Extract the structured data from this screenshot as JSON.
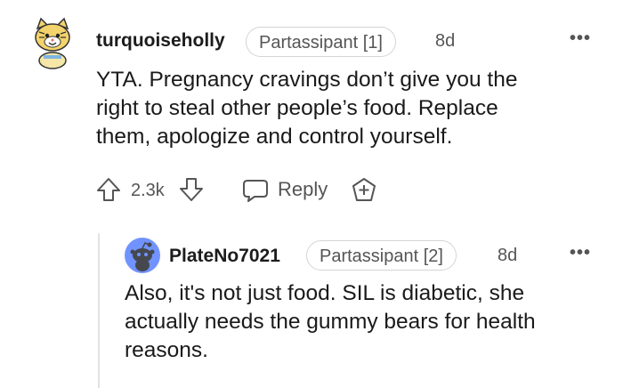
{
  "comment": {
    "username": "turquoiseholly",
    "flair": "Partassipant [1]",
    "age": "8d",
    "more": "•••",
    "body_lines": [
      "YTA. Pregnancy cravings don’t give you the",
      "right to steal other people’s food. Replace",
      "them, apologize and control yourself."
    ],
    "vote_count": "2.3k",
    "reply_label": "Reply"
  },
  "reply": {
    "username": "PlateNo7021",
    "flair": "Partassipant [2]",
    "age": "8d",
    "more": "•••",
    "body_lines": [
      "Also, it's not just food. SIL is diabetic, she",
      "actually needs the gummy bears for health",
      "reasons."
    ]
  },
  "colors": {
    "text": "#1a1a1b",
    "meta": "#555555",
    "border": "#d4d4d4",
    "avatar_blue": "#7193ff"
  }
}
